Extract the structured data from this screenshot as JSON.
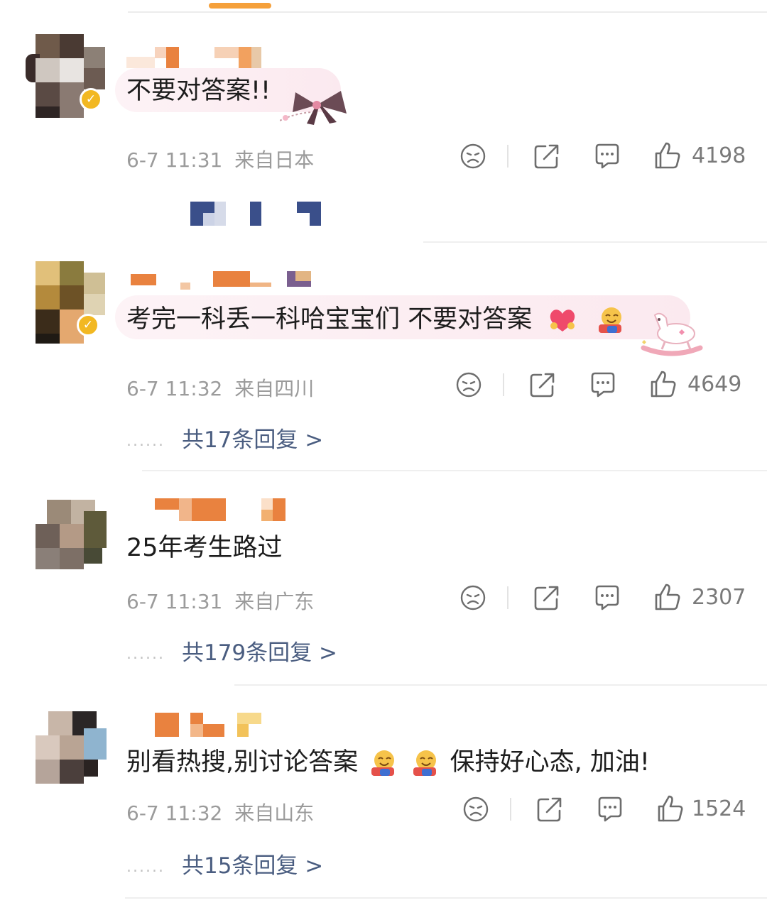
{
  "comments": [
    {
      "text": "不要对答案!!",
      "time": "6-7 11:31",
      "location": "来自日本",
      "likes": "4198",
      "verified": true,
      "verified_mark": "✓",
      "reply_text": "",
      "has_bubble": true,
      "bubble_decoration": "bow-icon"
    },
    {
      "text": "考完一科丢一科哈宝宝们 不要对答案",
      "time": "6-7 11:32",
      "location": "来自四川",
      "likes": "4649",
      "verified": true,
      "verified_mark": "✓",
      "reply_text": "共17条回复 >",
      "has_bubble": true,
      "bubble_decoration": "rocking-horse-icon"
    },
    {
      "text": "25年考生路过",
      "time": "6-7 11:31",
      "location": "来自广东",
      "likes": "2307",
      "verified": false,
      "reply_text": "共179条回复 >"
    },
    {
      "text_part1": "别看热搜,别讨论答案",
      "text_part2": "保持好心态, 加油!",
      "time": "6-7 11:32",
      "location": "来自山东",
      "likes": "1524",
      "verified": false,
      "reply_text": "共15条回复 >"
    }
  ],
  "reply_dots": "......",
  "icons": [
    "dislike-face-icon",
    "share-icon",
    "comment-icon",
    "like-thumb-icon"
  ],
  "colors": {
    "reply_link": "#4a5d80",
    "meta_gray": "#9b9b9b",
    "accent": "#f5a03a",
    "verified": "#f2b822"
  }
}
